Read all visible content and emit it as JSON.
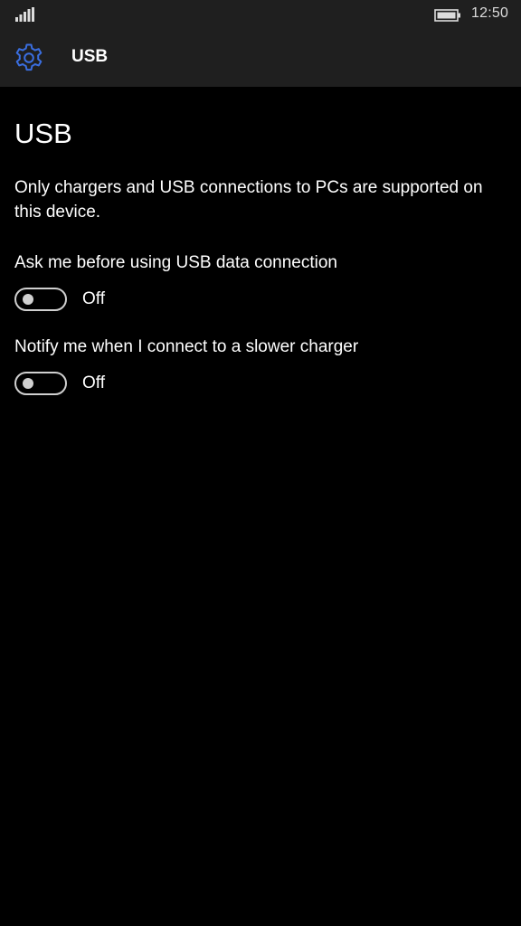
{
  "status_bar": {
    "time": "12:50",
    "signal_icon": "signal-bars-icon",
    "battery_icon": "battery-icon"
  },
  "header": {
    "icon": "gear-icon",
    "accent_color": "#3a6ee0",
    "title": "USB"
  },
  "page": {
    "title": "USB",
    "description": "Only chargers and USB connections to PCs are supported on this device."
  },
  "settings": [
    {
      "label": "Ask me before using USB data connection",
      "state": "Off"
    },
    {
      "label": "Notify me when I connect to a slower charger",
      "state": "Off"
    }
  ]
}
